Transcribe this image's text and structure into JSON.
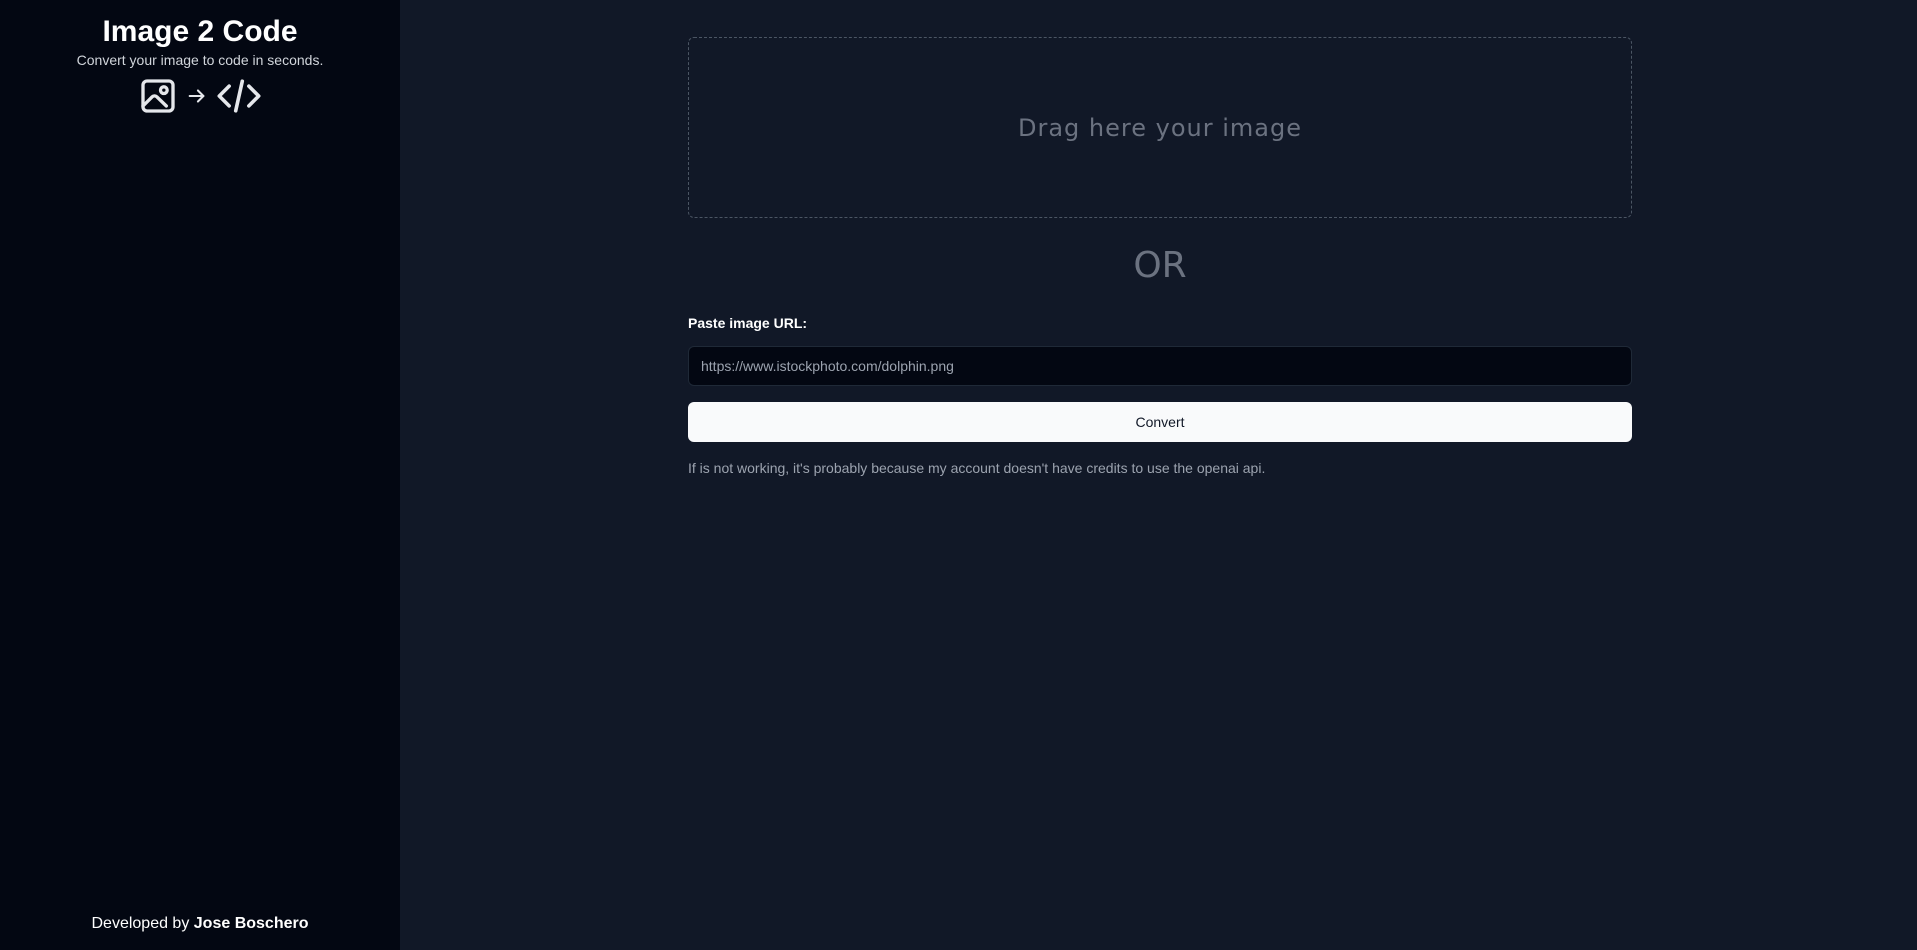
{
  "sidebar": {
    "title": "Image 2 Code",
    "subtitle": "Convert your image to code in seconds.",
    "icons": [
      "image-icon",
      "arrow-right-icon",
      "code-icon"
    ],
    "credit_prefix": "Developed by",
    "credit_author": "Jose Boschero"
  },
  "main": {
    "dropzone_text": "Drag here your image",
    "separator_text": "OR",
    "url_label": "Paste image URL:",
    "url_input": {
      "value": "",
      "placeholder": "https://www.istockphoto.com/dolphin.png"
    },
    "convert_label": "Convert",
    "notice": "If is not working, it's probably because my account doesn't have credits to use the openai api."
  },
  "colors": {
    "sidebar_bg": "#030712",
    "main_bg": "#111827",
    "button_bg": "#f9fafb",
    "muted_text": "#6b7280"
  }
}
